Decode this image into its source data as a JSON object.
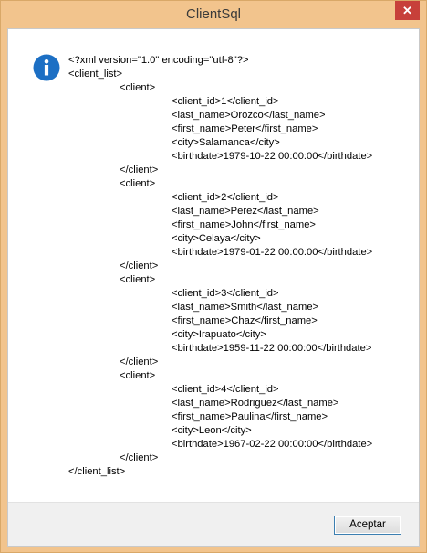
{
  "window": {
    "title": "ClientSql",
    "close_glyph": "✕"
  },
  "dialog": {
    "icon": "info-icon",
    "lines": [
      {
        "indent": 0,
        "text": "<?xml version=\"1.0\" encoding=\"utf-8\"?>"
      },
      {
        "indent": 0,
        "text": "<client_list>"
      },
      {
        "indent": 1,
        "text": "<client>"
      },
      {
        "indent": 2,
        "text": "<client_id>1</client_id>"
      },
      {
        "indent": 2,
        "text": "<last_name>Orozco</last_name>"
      },
      {
        "indent": 2,
        "text": "<first_name>Peter</first_name>"
      },
      {
        "indent": 2,
        "text": "<city>Salamanca</city>"
      },
      {
        "indent": 2,
        "text": "<birthdate>1979-10-22 00:00:00</birthdate>"
      },
      {
        "indent": 1,
        "text": "</client>"
      },
      {
        "indent": 1,
        "text": "<client>"
      },
      {
        "indent": 2,
        "text": "<client_id>2</client_id>"
      },
      {
        "indent": 2,
        "text": "<last_name>Perez</last_name>"
      },
      {
        "indent": 2,
        "text": "<first_name>John</first_name>"
      },
      {
        "indent": 2,
        "text": "<city>Celaya</city>"
      },
      {
        "indent": 2,
        "text": "<birthdate>1979-01-22 00:00:00</birthdate>"
      },
      {
        "indent": 1,
        "text": "</client>"
      },
      {
        "indent": 1,
        "text": "<client>"
      },
      {
        "indent": 2,
        "text": "<client_id>3</client_id>"
      },
      {
        "indent": 2,
        "text": "<last_name>Smith</last_name>"
      },
      {
        "indent": 2,
        "text": "<first_name>Chaz</first_name>"
      },
      {
        "indent": 2,
        "text": "<city>Irapuato</city>"
      },
      {
        "indent": 2,
        "text": "<birthdate>1959-11-22 00:00:00</birthdate>"
      },
      {
        "indent": 1,
        "text": "</client>"
      },
      {
        "indent": 1,
        "text": "<client>"
      },
      {
        "indent": 2,
        "text": "<client_id>4</client_id>"
      },
      {
        "indent": 2,
        "text": "<last_name>Rodriguez</last_name>"
      },
      {
        "indent": 2,
        "text": "<first_name>Paulina</first_name>"
      },
      {
        "indent": 2,
        "text": "<city>Leon</city>"
      },
      {
        "indent": 2,
        "text": "<birthdate>1967-02-22 00:00:00</birthdate>"
      },
      {
        "indent": 1,
        "text": "</client>"
      },
      {
        "indent": 0,
        "text": "</client_list>"
      }
    ]
  },
  "footer": {
    "ok_label": "Aceptar"
  }
}
